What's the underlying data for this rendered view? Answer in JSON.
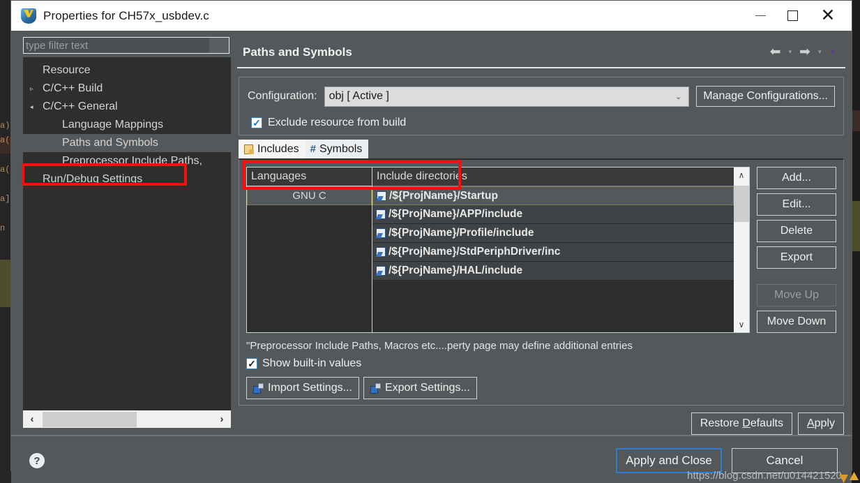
{
  "window": {
    "title": "Properties for CH57x_usbdev.c",
    "app_icon": "eclipse-shield-icon",
    "controls": {
      "minimize": "minimize-icon",
      "maximize": "maximize-icon",
      "close": "close-icon"
    }
  },
  "sidebar": {
    "filter": {
      "placeholder": "type filter text",
      "value": ""
    },
    "items": [
      {
        "label": "Resource",
        "level": 1,
        "arrow": "",
        "selected": false
      },
      {
        "label": "C/C++ Build",
        "level": 0,
        "arrow": "▹",
        "selected": false
      },
      {
        "label": "C/C++ General",
        "level": 0,
        "arrow": "◂",
        "selected": false
      },
      {
        "label": "Language Mappings",
        "level": 2,
        "arrow": "",
        "selected": false
      },
      {
        "label": "Paths and Symbols",
        "level": 2,
        "arrow": "",
        "selected": true
      },
      {
        "label": "Preprocessor Include Paths,",
        "level": 2,
        "arrow": "",
        "selected": false
      },
      {
        "label": "Run/Debug Settings",
        "level": 1,
        "arrow": "",
        "selected": false
      }
    ],
    "hscroll": {
      "left_arrow": "‹",
      "right_arrow": "›"
    }
  },
  "page": {
    "title": "Paths and Symbols",
    "nav": {
      "back": "⬅",
      "back_caret": "▾",
      "forward": "➡",
      "forward_caret": "▾",
      "menu_caret": "▾"
    }
  },
  "config": {
    "label": "Configuration:",
    "value": "obj  [ Active ]",
    "caret": "⌄",
    "manage_button": "Manage Configurations..."
  },
  "exclude": {
    "label": "Exclude resource from build",
    "checked": true,
    "tick": "✓"
  },
  "tabs": [
    {
      "label": "Includes",
      "icon": "includes-page-icon",
      "active": true
    },
    {
      "label": "Symbols",
      "icon": "hash-icon",
      "active": false
    }
  ],
  "table": {
    "languages_header": "Languages",
    "languages": [
      "GNU C"
    ],
    "directories_header": "Include directories",
    "directories": [
      "/${ProjName}/Startup",
      "/${ProjName}/APP/include",
      "/${ProjName}/Profile/include",
      "/${ProjName}/StdPeriphDriver/inc",
      "/${ProjName}/HAL/include"
    ],
    "scroll": {
      "up": "∧",
      "down": "∨"
    }
  },
  "side_buttons": [
    {
      "label": "Add...",
      "disabled": false
    },
    {
      "label": "Edit...",
      "disabled": false
    },
    {
      "label": "Delete",
      "disabled": false
    },
    {
      "label": "Export",
      "disabled": false
    },
    {
      "label": "Move Up",
      "disabled": true
    },
    {
      "label": "Move Down",
      "disabled": false
    }
  ],
  "note": "\"Preprocessor Include Paths, Macros etc....perty page may define additional entries",
  "builtin": {
    "label": "Show built-in values",
    "checked": true,
    "tick": "✓"
  },
  "io_buttons": [
    {
      "label": "Import Settings...",
      "icon": "import-settings-icon"
    },
    {
      "label": "Export Settings...",
      "icon": "export-settings-icon"
    }
  ],
  "apply_row": [
    {
      "label": "Restore Defaults",
      "mnemonic": "D"
    },
    {
      "label": "Apply",
      "mnemonic": "A"
    }
  ],
  "footer": {
    "help": "?",
    "buttons": [
      {
        "label": "Apply and Close",
        "primary": true
      },
      {
        "label": "Cancel",
        "primary": false
      }
    ]
  },
  "watermark": "https://blog.csdn.net/u014421520",
  "annotations": {
    "tree_highlight": "red-box-around-paths-and-symbols",
    "checkbox_highlight": "red-box-around-exclude-resource"
  },
  "background_code": "a)\na(\n\na(\n\na]\n\nn"
}
